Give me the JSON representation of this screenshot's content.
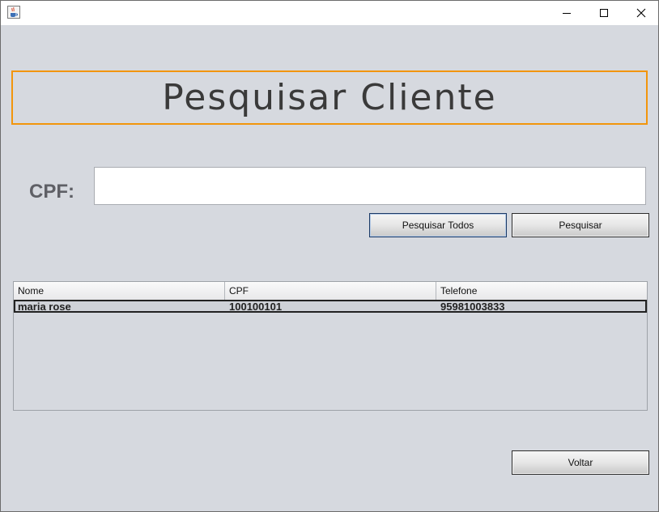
{
  "window": {
    "icon": "java-cup-icon",
    "controls": [
      "minimize-icon",
      "maximize-icon",
      "close-icon"
    ]
  },
  "header": {
    "title": "Pesquisar Cliente",
    "border_color": "#f2950c"
  },
  "search": {
    "cpf_label": "CPF:",
    "cpf_value": "",
    "btn_search_all": "Pesquisar Todos",
    "btn_search": "Pesquisar"
  },
  "table": {
    "columns": [
      "Nome",
      "CPF",
      "Telefone"
    ],
    "rows": [
      [
        "maria rose",
        "100100101",
        "95981003833"
      ]
    ]
  },
  "footer": {
    "btn_back": "Voltar"
  },
  "colors": {
    "background": "#d6d9df",
    "accent_border": "#f2950c"
  }
}
